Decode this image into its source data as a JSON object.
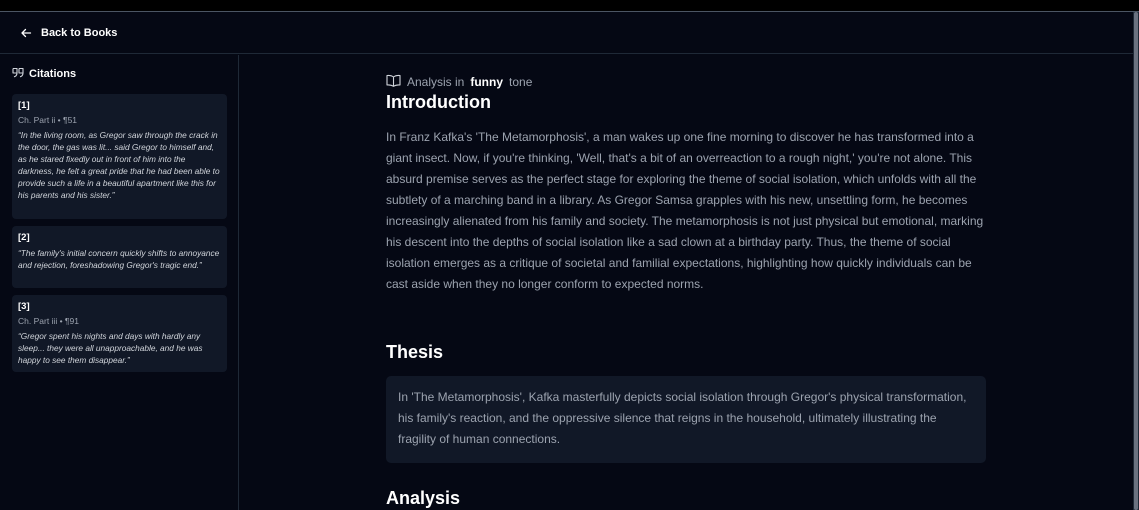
{
  "header": {
    "back_label": "Back to Books"
  },
  "sidebar": {
    "title": "Citations",
    "citations": [
      {
        "num": "[1]",
        "location": "Ch. Part ii • ¶51",
        "quote": "“In the living room, as Gregor saw through the crack in the door, the gas was lit... said Gregor to himself and, as he stared fixedly out in front of him into the darkness, he felt a great pride that he had been able to provide such a life in a beautiful apartment like this for his parents and his sister.”"
      },
      {
        "num": "[2]",
        "location": "",
        "quote": "“The family's initial concern quickly shifts to annoyance and rejection, foreshadowing Gregor's tragic end.”"
      },
      {
        "num": "[3]",
        "location": "Ch. Part iii • ¶91",
        "quote": "“Gregor spent his nights and days with hardly any sleep... they were all unapproachable, and he was happy to see them disappear.”"
      }
    ]
  },
  "main": {
    "tone_prefix": "Analysis in",
    "tone_value": "funny",
    "tone_suffix": "tone",
    "intro_heading": "Introduction",
    "intro_text": "In Franz Kafka's 'The Metamorphosis', a man wakes up one fine morning to discover he has transformed into a giant insect. Now, if you're thinking, 'Well, that's a bit of an overreaction to a rough night,' you're not alone. This absurd premise serves as the perfect stage for exploring the theme of social isolation, which unfolds with all the subtlety of a marching band in a library. As Gregor Samsa grapples with his new, unsettling form, he becomes increasingly alienated from his family and society. The metamorphosis is not just physical but emotional, marking his descent into the depths of social isolation like a sad clown at a birthday party. Thus, the theme of social isolation emerges as a critique of societal and familial expectations, highlighting how quickly individuals can be cast aside when they no longer conform to expected norms.",
    "thesis_heading": "Thesis",
    "thesis_text": "In 'The Metamorphosis', Kafka masterfully depicts social isolation through Gregor's physical transformation, his family's reaction, and the oppressive silence that reigns in the household, ultimately illustrating the fragility of human connections.",
    "analysis_heading": "Analysis"
  },
  "icons": {
    "back": "arrow-left-icon",
    "citations": "quote-icon",
    "tone": "book-open-icon"
  },
  "colors": {
    "background": "#050814",
    "card": "#111827",
    "text_primary": "#ffffff",
    "text_secondary": "#9ca3af",
    "border": "#1f2937"
  }
}
